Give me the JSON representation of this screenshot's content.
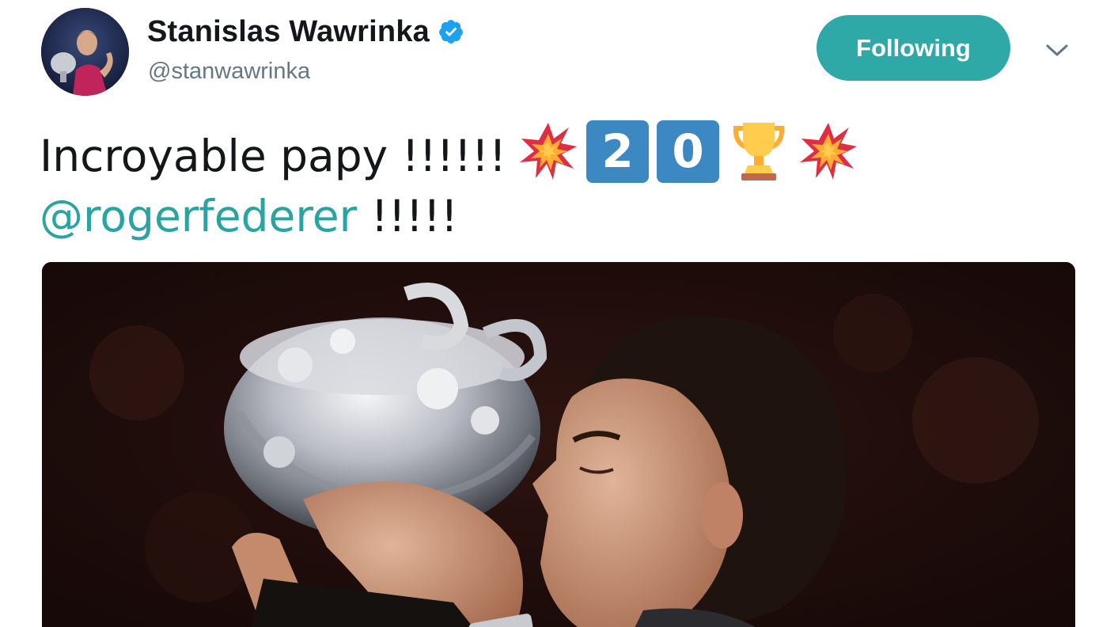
{
  "user": {
    "display_name": "Stanislas Wawrinka",
    "handle": "@stanwawrinka",
    "verified": true
  },
  "actions": {
    "follow_label": "Following"
  },
  "tweet": {
    "line1_text": "Incroyable papy !!!!!! ",
    "emoji": [
      "collision-icon",
      "keycap-2",
      "keycap-0",
      "trophy-icon",
      "collision-icon"
    ],
    "keycap_digits": [
      "2",
      "0"
    ],
    "mention": "@rogerfederer",
    "line2_suffix": " !!!!!"
  },
  "colors": {
    "accent": "#2fa8a8",
    "mention": "#2aa3a3",
    "verified": "#1da1f2",
    "handle": "#657786",
    "keycap": "#3b88c3"
  }
}
